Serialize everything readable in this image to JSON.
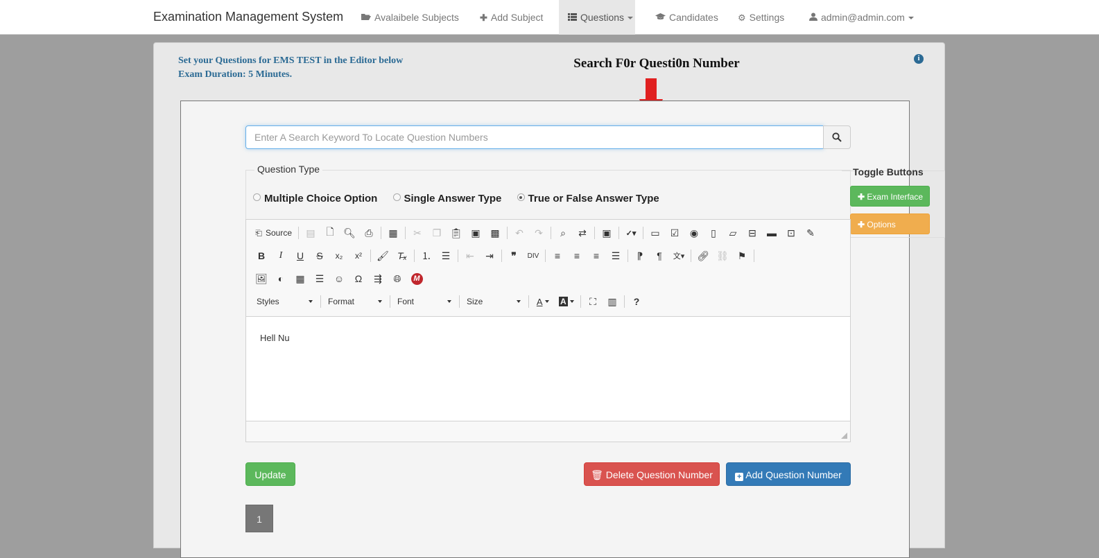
{
  "navbar": {
    "brand": "Examination Management System",
    "items": [
      {
        "label": "Avalaibele Subjects",
        "icon": "folder-open-icon"
      },
      {
        "label": "Add Subject",
        "icon": "plus-icon"
      },
      {
        "label": "Questions",
        "icon": "list-icon"
      },
      {
        "label": "Candidates",
        "icon": "graduation-cap-icon"
      },
      {
        "label": "Settings",
        "icon": "gear-icon"
      },
      {
        "label": "admin@admin.com",
        "icon": "user-icon"
      }
    ]
  },
  "info": {
    "line1": "Set your Questions for EMS TEST in the Editor below",
    "line2": "Exam Duration: 5 Minutes."
  },
  "annotation": {
    "title": "Search F0r Questi0n Number",
    "arrow_color": "#e02020"
  },
  "search": {
    "placeholder": "Enter A Search Keyword To Locate Question Numbers"
  },
  "question_type": {
    "legend": "Question Type",
    "options": [
      "Multiple Choice Option",
      "Single Answer Type",
      "True or False Answer Type"
    ],
    "selected": "True or False Answer Type"
  },
  "toggle": {
    "title": "Toggle Buttons",
    "exam_interface": "Exam Interface",
    "options": "Options"
  },
  "editor": {
    "source_label": "Source",
    "styles_label": "Styles",
    "format_label": "Format",
    "font_label": "Font",
    "size_label": "Size",
    "content": "Hell Nu"
  },
  "buttons": {
    "update": "Update",
    "delete": "Delete Question Number",
    "add": "Add Question Number"
  },
  "pagination": {
    "current": "1"
  },
  "colors": {
    "success": "#5cb85c",
    "danger": "#d9534f",
    "primary": "#337ab7",
    "warning": "#f0ad4e",
    "info_text": "#2b6a94"
  }
}
